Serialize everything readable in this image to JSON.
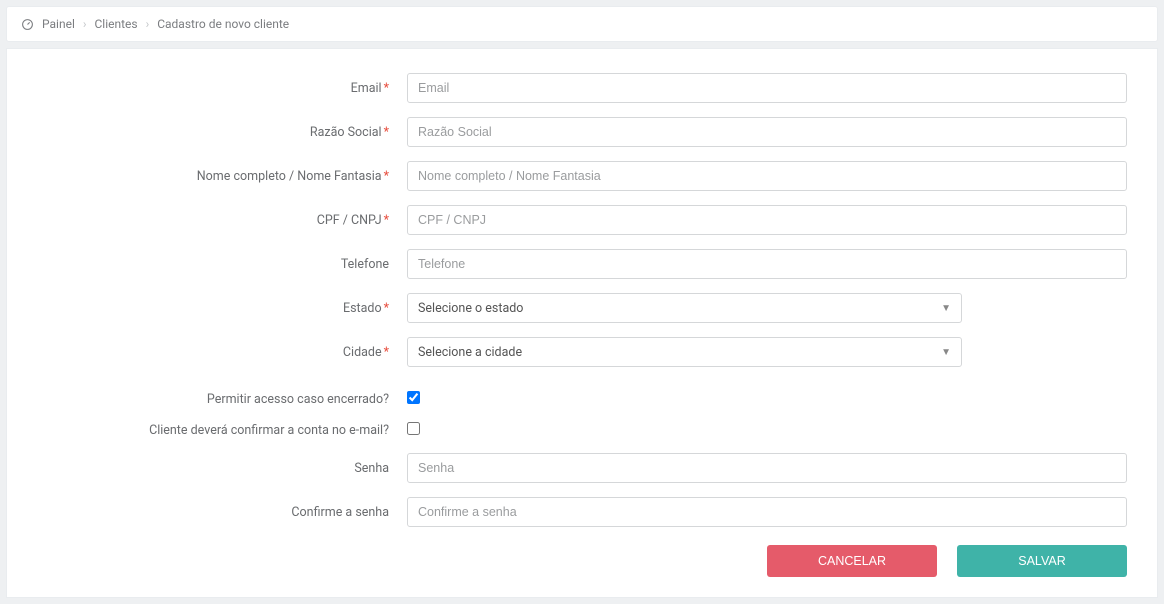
{
  "breadcrumb": {
    "items": [
      "Painel",
      "Clientes",
      "Cadastro de novo cliente"
    ]
  },
  "form": {
    "email": {
      "label": "Email",
      "placeholder": "Email",
      "value": "",
      "required": true
    },
    "razao_social": {
      "label": "Razão Social",
      "placeholder": "Razão Social",
      "value": "",
      "required": true
    },
    "nome_fantasia": {
      "label": "Nome completo / Nome Fantasia",
      "placeholder": "Nome completo / Nome Fantasia",
      "value": "",
      "required": true
    },
    "cpf_cnpj": {
      "label": "CPF / CNPJ",
      "placeholder": "CPF / CNPJ",
      "value": "",
      "required": true
    },
    "telefone": {
      "label": "Telefone",
      "placeholder": "Telefone",
      "value": "",
      "required": false
    },
    "estado": {
      "label": "Estado",
      "placeholder": "Selecione o estado",
      "value": "Selecione o estado",
      "required": true
    },
    "cidade": {
      "label": "Cidade",
      "placeholder": "Selecione a cidade",
      "value": "Selecione a cidade",
      "required": true
    },
    "permitir_acesso": {
      "label": "Permitir acesso caso encerrado?",
      "checked": true
    },
    "confirmar_email": {
      "label": "Cliente deverá confirmar a conta no e-mail?",
      "checked": false
    },
    "senha": {
      "label": "Senha",
      "placeholder": "Senha",
      "value": "",
      "required": false
    },
    "confirme_senha": {
      "label": "Confirme a senha",
      "placeholder": "Confirme a senha",
      "value": "",
      "required": false
    }
  },
  "buttons": {
    "cancel": "CANCELAR",
    "save": "SALVAR"
  }
}
